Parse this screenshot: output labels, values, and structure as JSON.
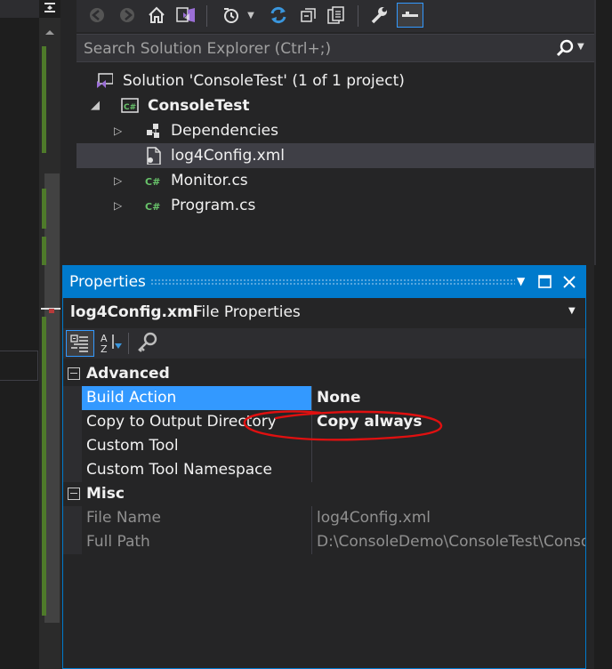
{
  "search": {
    "placeholder": "Search Solution Explorer (Ctrl+;)"
  },
  "tree": {
    "items": [
      {
        "label": "Solution 'ConsoleTest' (1 of 1 project)",
        "icon": "solution-icon"
      },
      {
        "label": "ConsoleTest",
        "icon": "csharp-project-icon",
        "expanded": true
      },
      {
        "label": "Dependencies",
        "icon": "dependencies-icon"
      },
      {
        "label": "log4Config.xml",
        "icon": "xml-file-icon",
        "selected": true
      },
      {
        "label": "Monitor.cs",
        "icon": "csharp-file-icon"
      },
      {
        "label": "Program.cs",
        "icon": "csharp-file-icon"
      }
    ]
  },
  "properties": {
    "title": "Properties",
    "object_name": "log4Config.xml",
    "object_type": "File Properties",
    "categories": [
      {
        "name": "Advanced",
        "rows": [
          {
            "name": "Build Action",
            "value": "None"
          },
          {
            "name": "Copy to Output Directory",
            "value": "Copy always"
          },
          {
            "name": "Custom Tool",
            "value": ""
          },
          {
            "name": "Custom Tool Namespace",
            "value": ""
          }
        ]
      },
      {
        "name": "Misc",
        "rows": [
          {
            "name": "File Name",
            "value": "log4Config.xml"
          },
          {
            "name": "Full Path",
            "value": "D:\\ConsoleDemo\\ConsoleTest\\Console"
          }
        ]
      }
    ]
  },
  "colors": {
    "accent": "#007acc",
    "selection": "#3399ff",
    "csharp_green": "#68c36a",
    "annotation_red": "#e01010"
  }
}
